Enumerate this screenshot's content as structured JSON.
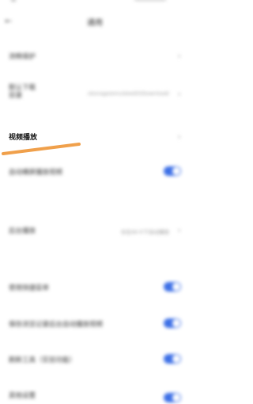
{
  "status": {
    "right_text": ""
  },
  "header": {
    "back_icon": "back-arrow-icon",
    "title": "通用"
  },
  "rows": [
    {
      "label": "流畅保护",
      "value": ""
    },
    {
      "label": "默认下载\n目录",
      "value": "/storage/emulated/0/Download/"
    },
    {
      "label": "视频播放",
      "value": ""
    },
    {
      "label": "自动横屏播放视频",
      "toggle": true
    },
    {
      "label": "后台播放",
      "value": "仅在Wi-Fi下自动播放"
    },
    {
      "label": "使用快捷菜单",
      "toggle": true
    },
    {
      "label": "保存浏览记录后台自动播放视频",
      "toggle": true
    },
    {
      "label": "刷新工具（实验功能）",
      "toggle": true
    },
    {
      "label": "其他设置",
      "toggle": true
    }
  ],
  "colors": {
    "accent": "#3c6fe6",
    "highlight_stroke": "#f0a04b"
  }
}
